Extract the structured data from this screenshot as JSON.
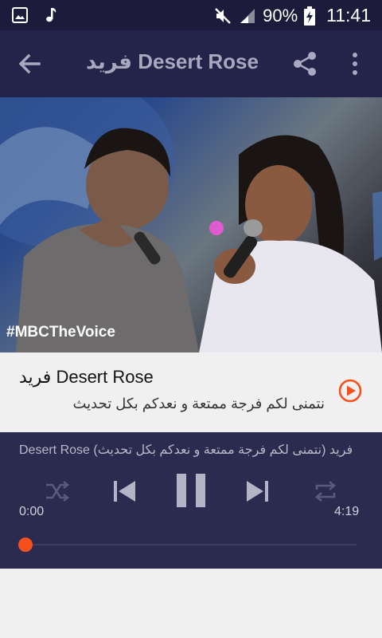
{
  "status_bar": {
    "battery_percent": "90%",
    "time": "11:41"
  },
  "app_bar": {
    "title": "فريد  Desert Rose"
  },
  "video": {
    "hashtag": "#MBCTheVoice"
  },
  "song": {
    "title": "فريد  Desert Rose",
    "subtitle": "نتمنى لكم فرجة ممتعة و نعدكم بكل تحديث"
  },
  "player": {
    "now_playing": "فريد (نتمنى لكم فرجة ممتعة و نعدكم بكل تحديث)  Desert Rose",
    "current_time": "0:00",
    "total_time": "4:19",
    "progress": 0.0
  },
  "colors": {
    "status_bar_bg": "#1c1b3b",
    "app_bar_bg": "#24244a",
    "player_bg": "#2b2b4f",
    "accent": "#f4511e"
  }
}
